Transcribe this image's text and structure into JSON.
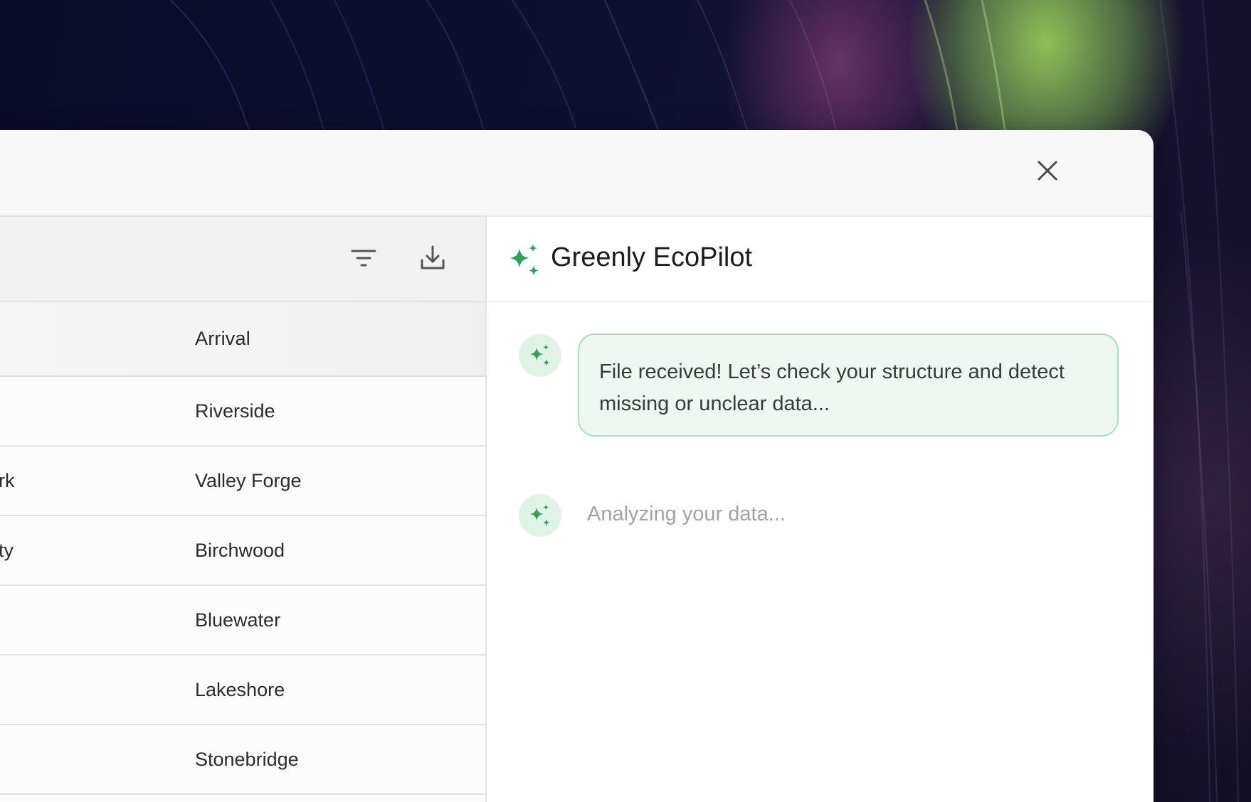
{
  "colors": {
    "accent_green": "#2fa35c",
    "bubble_bg": "#ecf8f1",
    "bubble_border": "#a8e2bd",
    "avatar_bg": "#dff3e6",
    "muted_text": "#a2a2a2"
  },
  "window": {
    "close_icon": "close-icon"
  },
  "table": {
    "toolbar": {
      "filter_icon": "filter-icon",
      "download_icon": "download-icon"
    },
    "columns": {
      "arrival": "Arrival"
    },
    "rows": [
      {
        "departure": "",
        "arrival": "Riverside"
      },
      {
        "departure": "rk",
        "arrival": "Valley Forge"
      },
      {
        "departure": "ty",
        "arrival": "Birchwood"
      },
      {
        "departure": "",
        "arrival": "Bluewater"
      },
      {
        "departure": "",
        "arrival": "Lakeshore"
      },
      {
        "departure": "",
        "arrival": "Stonebridge"
      }
    ]
  },
  "chat": {
    "title": "Greenly EcoPilot",
    "icon": "sparkles-icon",
    "messages": [
      {
        "text": "File received! Let’s check your structure and detect missing or unclear data..."
      }
    ],
    "status": "Analyzing your data..."
  }
}
